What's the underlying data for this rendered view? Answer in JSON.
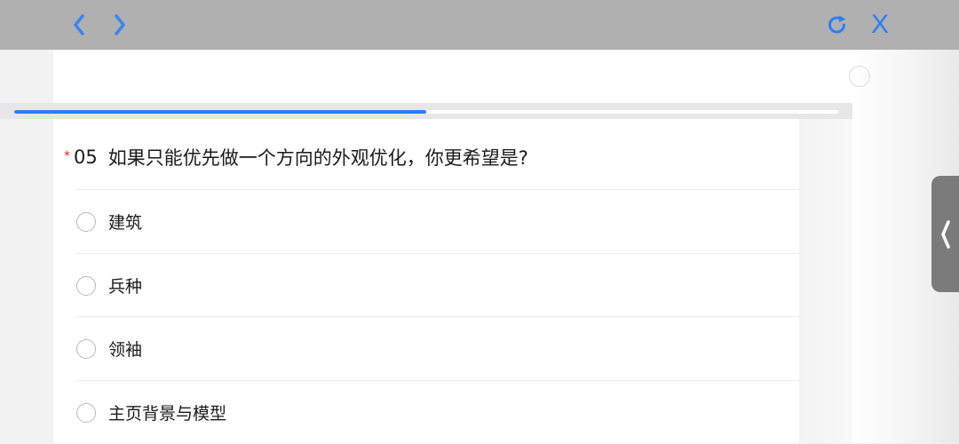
{
  "toolbar": {
    "back_icon": "chevron-left-icon",
    "forward_icon": "chevron-right-icon",
    "refresh_icon": "refresh-icon",
    "close_label": "X",
    "accent_color": "#2a7ff2"
  },
  "progress": {
    "fraction": 0.5
  },
  "question": {
    "required_mark": "*",
    "number": "05",
    "text": "如果只能优先做一个方向的外观优化，你更希望是?",
    "options": [
      "建筑",
      "兵种",
      "领袖",
      "主页背景与模型"
    ]
  },
  "side_tab": {
    "icon": "chevron-left-icon"
  }
}
